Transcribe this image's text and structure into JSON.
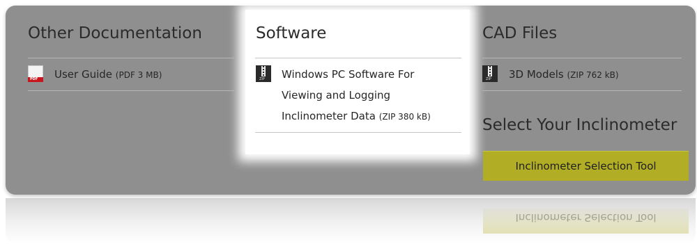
{
  "columns": {
    "documentation": {
      "title": "Other Documentation",
      "items": [
        {
          "label": "User Guide",
          "meta": "(PDF 3 MB)",
          "icon": "pdf-icon"
        }
      ]
    },
    "software": {
      "title": "Software",
      "items": [
        {
          "label_lines": [
            "Windows PC Software For",
            "Viewing and Logging",
            "Inclinometer Data"
          ],
          "meta": "(ZIP 380 kB)",
          "icon": "zip-icon"
        }
      ]
    },
    "cad": {
      "title": "CAD Files",
      "items": [
        {
          "label": "3D Models",
          "meta": "(ZIP 762 kB)",
          "icon": "zip-icon"
        }
      ]
    }
  },
  "select": {
    "heading": "Select Your Inclinometer",
    "button_label": "Inclinometer Selection Tool"
  },
  "reflection": {
    "button_label": "Inclinometer Selection Tool"
  },
  "colors": {
    "panel": "#8f8f8f",
    "highlight": "#ffffff",
    "button": "#b1ad24",
    "pdf_red": "#c8161d"
  }
}
